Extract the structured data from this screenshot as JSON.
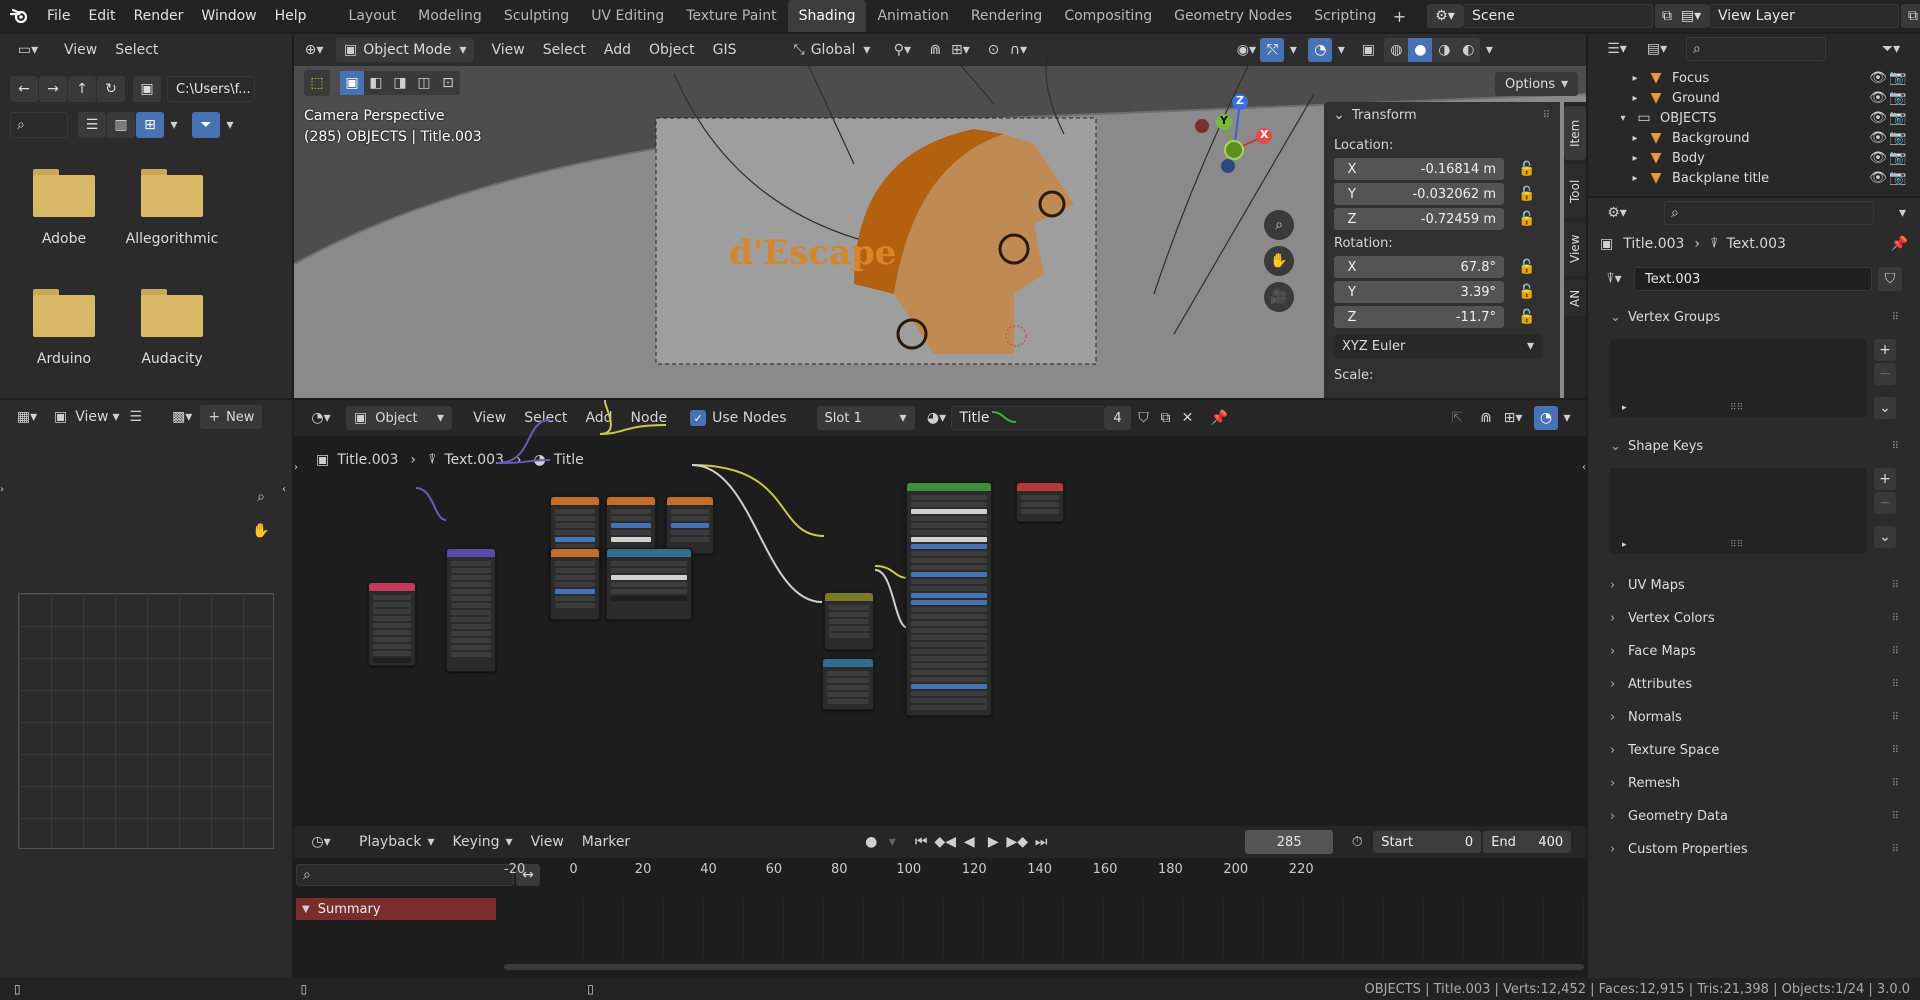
{
  "app_menu": [
    "File",
    "Edit",
    "Render",
    "Window",
    "Help"
  ],
  "workspaces": [
    {
      "label": "Layout",
      "active": false
    },
    {
      "label": "Modeling",
      "active": false
    },
    {
      "label": "Sculpting",
      "active": false
    },
    {
      "label": "UV Editing",
      "active": false
    },
    {
      "label": "Texture Paint",
      "active": false
    },
    {
      "label": "Shading",
      "active": true
    },
    {
      "label": "Animation",
      "active": false
    },
    {
      "label": "Rendering",
      "active": false
    },
    {
      "label": "Compositing",
      "active": false
    },
    {
      "label": "Geometry Nodes",
      "active": false
    },
    {
      "label": "Scripting",
      "active": false
    }
  ],
  "scene": {
    "name": "Scene",
    "view_layer": "View Layer"
  },
  "file_browser": {
    "view_label": "View",
    "select_label": "Select",
    "path": "C:\\Users\\f...",
    "folders": [
      "Adobe",
      "Allegorithmic",
      "Arduino",
      "Audacity"
    ]
  },
  "viewport": {
    "mode": "Object Mode",
    "menus": [
      "View",
      "Select",
      "Add",
      "Object",
      "GIS"
    ],
    "orientation": "Global",
    "options_label": "Options",
    "camera_label": "Camera Perspective",
    "object_label": "(285) OBJECTS | Title.003",
    "overlay_text": "d'Escape",
    "side_tabs": [
      "Item",
      "Tool",
      "View",
      "AN"
    ],
    "transform": {
      "title": "Transform",
      "location_label": "Location:",
      "location": [
        {
          "axis": "X",
          "value": "-0.16814 m"
        },
        {
          "axis": "Y",
          "value": "-0.032062 m"
        },
        {
          "axis": "Z",
          "value": "-0.72459 m"
        }
      ],
      "rotation_label": "Rotation:",
      "rotation": [
        {
          "axis": "X",
          "value": "67.8°"
        },
        {
          "axis": "Y",
          "value": "3.39°"
        },
        {
          "axis": "Z",
          "value": "-11.7°"
        }
      ],
      "rotation_mode": "XYZ Euler",
      "scale_label": "Scale:"
    },
    "gizmo": {
      "x": "X",
      "y": "Y",
      "z": "Z"
    }
  },
  "image_editor": {
    "view_label": "View",
    "new_label": "New"
  },
  "node_editor": {
    "type": "Object",
    "menus": [
      "View",
      "Select",
      "Add",
      "Node"
    ],
    "use_nodes_label": "Use Nodes",
    "use_nodes": true,
    "slot": "Slot 1",
    "material": "Title",
    "users": "4",
    "breadcrumb": [
      "Title.003",
      "Text.003",
      "Title"
    ]
  },
  "timeline": {
    "menus": [
      "Playback",
      "Keying",
      "View",
      "Marker"
    ],
    "current_frame": "285",
    "start_label": "Start",
    "start": "0",
    "end_label": "End",
    "end": "400",
    "ticks": [
      "-20",
      "0",
      "20",
      "40",
      "60",
      "80",
      "100",
      "120",
      "140",
      "160",
      "180",
      "200",
      "220"
    ],
    "summary_label": "Summary"
  },
  "outliner": {
    "items": [
      {
        "name": "Focus",
        "indent": 1,
        "type": "object"
      },
      {
        "name": "Ground",
        "indent": 1,
        "type": "object"
      },
      {
        "name": "OBJECTS",
        "indent": 0,
        "type": "collection"
      },
      {
        "name": "Background",
        "indent": 1,
        "type": "object"
      },
      {
        "name": "Body",
        "indent": 1,
        "type": "object"
      },
      {
        "name": "Backplane title",
        "indent": 1,
        "type": "object"
      }
    ]
  },
  "properties": {
    "breadcrumb": [
      "Title.003",
      "Text.003"
    ],
    "data_name": "Text.003",
    "vertex_groups_label": "Vertex Groups",
    "shape_keys_label": "Shape Keys",
    "panels": [
      "UV Maps",
      "Vertex Colors",
      "Face Maps",
      "Attributes",
      "Normals",
      "Texture Space",
      "Remesh",
      "Geometry Data",
      "Custom Properties"
    ]
  },
  "status_bar": {
    "text": "OBJECTS | Title.003 | Verts:12,452 | Faces:12,915 | Tris:21,398 | Objects:1/24 | 3.0.0"
  },
  "colors": {
    "accent": "#4772b3",
    "header": "#232323",
    "panel": "#303030",
    "summary": "#7a2d2d"
  }
}
